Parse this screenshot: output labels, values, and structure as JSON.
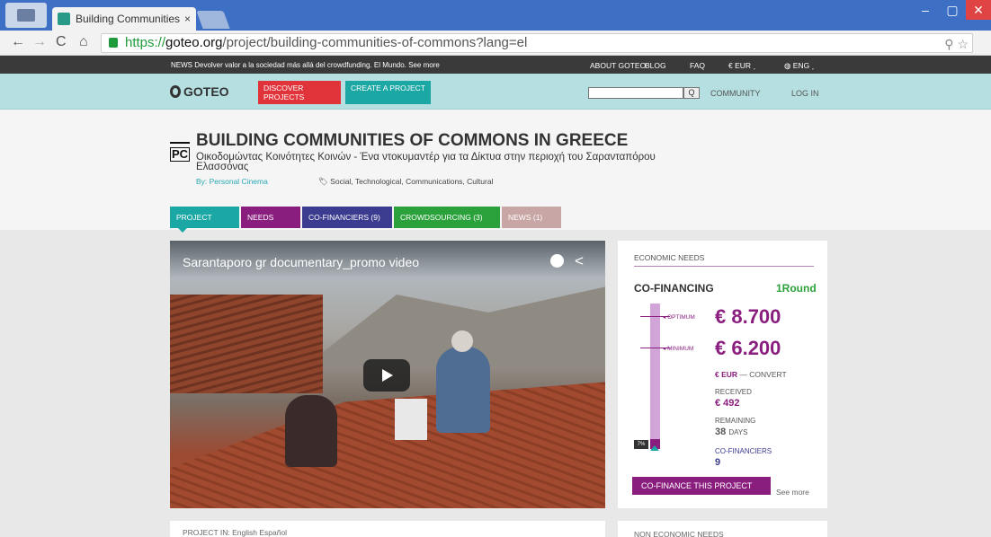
{
  "browser": {
    "tab_title": "Building Communities of",
    "tab_close": "×",
    "url_prefix": "https://",
    "url_domain": "goteo.org",
    "url_path": "/project/building-communities-of-commons?lang=el",
    "zoom_icon": "⚲",
    "star_icon": "☆",
    "min": "–",
    "max": "▢",
    "close": "✕",
    "back": "←",
    "forward": "→",
    "reload": "C",
    "home": "⌂"
  },
  "newsbar": {
    "text": "NEWS Devolver valor a la sociedad más allá del crowdfunding. El Mundo. See more",
    "about": "ABOUT GOTEO",
    "blog": "BLOG",
    "faq": "FAQ",
    "currency": "€ EUR ˯",
    "lang": "ENG ˯"
  },
  "header": {
    "logo": "GOTEO",
    "discover": "DISCOVER PROJECTS",
    "create": "CREATE A PROJECT",
    "search_icon": "Q",
    "community": "COMMUNITY",
    "login": "LOG IN"
  },
  "project": {
    "avatar": "PC",
    "title": "BUILDING COMMUNITIES OF COMMONS IN GREECE",
    "subtitle": "Οικοδομώντας Κοινότητες Κοινών - Ένα ντοκυμαντέρ για τα Δίκτυα στην περιοχή του Σαρανταπόρου Ελασσόνας",
    "by": "By: Personal Cinema",
    "tags": "Social, Technological, Communications, Cultural",
    "tag_icon": "🏷"
  },
  "tabs": {
    "project": "PROJECT",
    "needs": "NEEDS",
    "cofinanciers": "CO-FINANCIERS  (9)",
    "crowdsourcing": "CROWDSOURCING  (3)",
    "news": "NEWS  (1)"
  },
  "video": {
    "title": "Sarantaporo gr documentary_promo video",
    "share_icon": "<"
  },
  "econ": {
    "heading": "ECONOMIC NEEDS",
    "cofinancing": "CO-FINANCING",
    "round": "1Round",
    "optimum_label": "◂ OPTIMUM",
    "optimum": "€ 8.700",
    "minimum_label": "◂ MINIMUM",
    "minimum": "€ 6.200",
    "currency": "€ EUR",
    "convert": " — CONVERT",
    "received_label": "RECEIVED",
    "received": "€ 492",
    "remaining_label": "REMAINING",
    "remaining_num": "38",
    "remaining_unit": "DAYS",
    "cofinanciers_label": "CO-FINANCIERS",
    "cofinanciers": "9",
    "percent": "7%",
    "progress": 0.07,
    "button": "CO-FINANCE THIS PROJECT",
    "see_more": "See more"
  },
  "bottom": {
    "project_in": "PROJECT IN:  English  Español",
    "non_economic": "NON ECONOMIC NEEDS"
  },
  "colors": {
    "teal": "#1ba7a3",
    "purple": "#8a1e7f",
    "red": "#e0343a",
    "green": "#2aa13b",
    "navy": "#3b3b8f"
  }
}
